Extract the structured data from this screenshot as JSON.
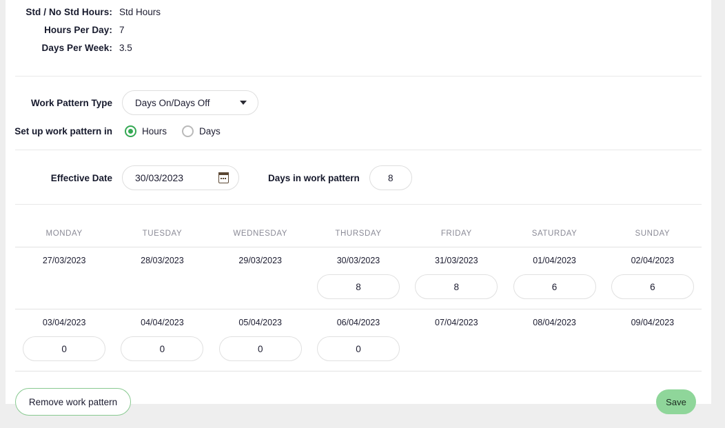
{
  "summary": {
    "rows": [
      {
        "label": "Std / No Std Hours:",
        "value": "Std Hours"
      },
      {
        "label": "Hours Per Day:",
        "value": "7"
      },
      {
        "label": "Days Per Week:",
        "value": "3.5"
      }
    ]
  },
  "work_pattern": {
    "type_label": "Work Pattern Type",
    "type_value": "Days On/Days Off",
    "setup_label": "Set up work pattern in",
    "options": [
      {
        "label": "Hours",
        "selected": true
      },
      {
        "label": "Days",
        "selected": false
      }
    ]
  },
  "effective": {
    "date_label": "Effective Date",
    "date_value": "30/03/2023",
    "days_label": "Days in work pattern",
    "days_value": "8"
  },
  "table": {
    "headers": [
      "MONDAY",
      "TUESDAY",
      "WEDNESDAY",
      "THURSDAY",
      "FRIDAY",
      "SATURDAY",
      "SUNDAY"
    ],
    "weeks": [
      {
        "dates": [
          "27/03/2023",
          "28/03/2023",
          "29/03/2023",
          "30/03/2023",
          "31/03/2023",
          "01/04/2023",
          "02/04/2023"
        ],
        "values": [
          "",
          "",
          "",
          "8",
          "8",
          "6",
          "6"
        ]
      },
      {
        "dates": [
          "03/04/2023",
          "04/04/2023",
          "05/04/2023",
          "06/04/2023",
          "07/04/2023",
          "08/04/2023",
          "09/04/2023"
        ],
        "values": [
          "0",
          "0",
          "0",
          "0",
          "",
          "",
          ""
        ]
      }
    ]
  },
  "footer": {
    "remove_label": "Remove work pattern",
    "save_label": "Save"
  },
  "colors": {
    "accent_green": "#34a853",
    "save_green": "#8fd69a",
    "border_green": "#87c98f",
    "page_bg": "#eeeeee"
  }
}
